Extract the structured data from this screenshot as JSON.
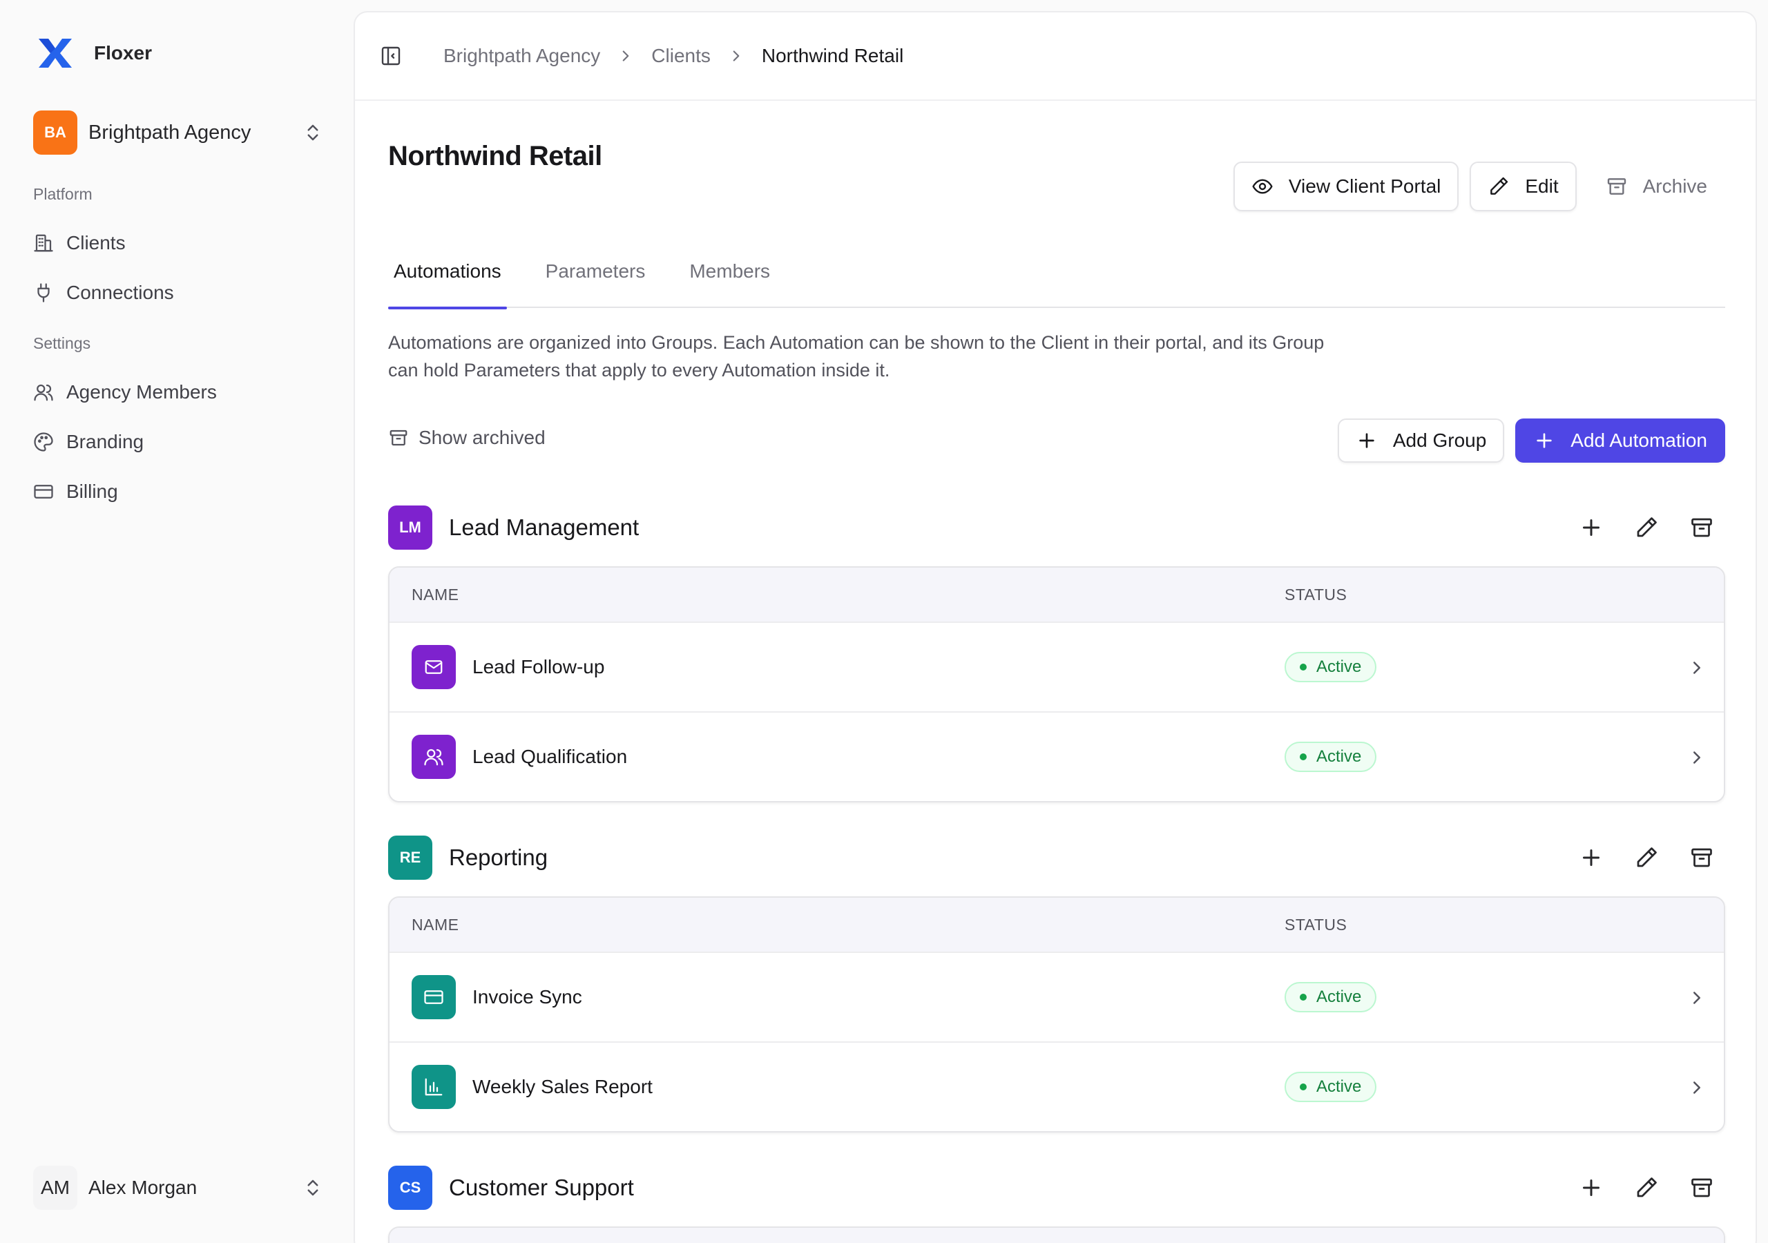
{
  "app": {
    "name": "Floxer"
  },
  "workspace": {
    "initials": "BA",
    "name": "Brightpath Agency",
    "color": "#f97316"
  },
  "sidebar": {
    "platform_label": "Platform",
    "platform_items": [
      {
        "label": "Clients",
        "icon": "building-icon"
      },
      {
        "label": "Connections",
        "icon": "plug-icon"
      }
    ],
    "settings_label": "Settings",
    "settings_items": [
      {
        "label": "Agency Members",
        "icon": "users-icon"
      },
      {
        "label": "Branding",
        "icon": "palette-icon"
      },
      {
        "label": "Billing",
        "icon": "credit-card-icon"
      }
    ]
  },
  "user": {
    "initials": "AM",
    "name": "Alex Morgan"
  },
  "breadcrumb": [
    "Brightpath Agency",
    "Clients",
    "Northwind Retail"
  ],
  "page": {
    "title": "Northwind Retail",
    "actions": {
      "view_portal": "View Client Portal",
      "edit": "Edit",
      "archive": "Archive"
    },
    "tabs": [
      "Automations",
      "Parameters",
      "Members"
    ],
    "active_tab": "Automations",
    "description": "Automations are organized into Groups. Each Automation can be shown to the Client in their portal, and its Group can hold Parameters that apply to every Automation inside it.",
    "show_archived": "Show archived",
    "add_group": "Add Group",
    "add_automation": "Add Automation"
  },
  "table_headers": {
    "name": "NAME",
    "status": "STATUS"
  },
  "groups": [
    {
      "initials": "LM",
      "name": "Lead Management",
      "color": "#7e22ce",
      "rows": [
        {
          "name": "Lead Follow-up",
          "status": "Active",
          "icon": "mail-icon"
        },
        {
          "name": "Lead Qualification",
          "status": "Active",
          "icon": "users-icon"
        }
      ]
    },
    {
      "initials": "RE",
      "name": "Reporting",
      "color": "#0f9488",
      "rows": [
        {
          "name": "Invoice Sync",
          "status": "Active",
          "icon": "credit-card-icon"
        },
        {
          "name": "Weekly Sales Report",
          "status": "Active",
          "icon": "bar-chart-icon"
        }
      ]
    },
    {
      "initials": "CS",
      "name": "Customer Support",
      "color": "#2563eb",
      "rows": []
    }
  ],
  "colors": {
    "accent": "#4f46e5",
    "status_active": "#15803d"
  }
}
